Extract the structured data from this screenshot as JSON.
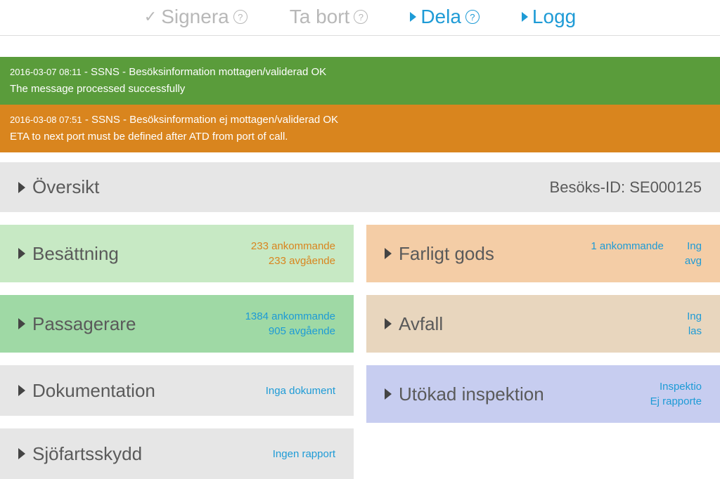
{
  "topbar": {
    "signera": "Signera",
    "tabort": "Ta bort",
    "dela": "Dela",
    "logg": "Logg"
  },
  "messages": [
    {
      "status": "ok",
      "timestamp": "2016-03-07 08:11",
      "title": "SSNS - Besöksinformation mottagen/validerad OK",
      "body": "The message processed successfully"
    },
    {
      "status": "warn",
      "timestamp": "2016-03-08 07:51",
      "title": "SSNS - Besöksinformation ej mottagen/validerad OK",
      "body": "ETA to next port must be defined after ATD from port of call."
    }
  ],
  "overview": {
    "title": "Översikt",
    "visit_id_label": "Besöks-ID: SE000125"
  },
  "cards": {
    "besattning": {
      "title": "Besättning",
      "line1": "233 ankommande",
      "line2": "233 avgående"
    },
    "passagerare": {
      "title": "Passagerare",
      "line1": "1384 ankommande",
      "line2": "905 avgående"
    },
    "dokumentation": {
      "title": "Dokumentation",
      "line1": "Inga dokument"
    },
    "sjofartsskydd": {
      "title": "Sjöfartsskydd",
      "line1": "Ingen rapport"
    },
    "farligt": {
      "title": "Farligt gods",
      "line1": "1 ankommande",
      "line2a": "Ing",
      "line2b": "avg"
    },
    "avfall": {
      "title": "Avfall",
      "line1": "Ing",
      "line2": "las"
    },
    "inspektion": {
      "title": "Utökad inspektion",
      "line1": "Inspektio",
      "line2": "Ej rapporte"
    }
  }
}
